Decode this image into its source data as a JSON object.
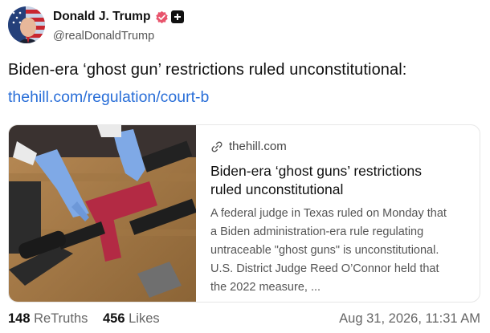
{
  "author": {
    "display_name": "Donald J. Trump",
    "handle": "@realDonaldTrump",
    "verified_color": "#e8546c",
    "avatar_icon": "flag-avatar-icon",
    "badge_icon": "plus-badge-icon"
  },
  "post": {
    "text": "Biden-era ‘ghost gun’ restrictions ruled unconstitutional:",
    "link_text": "thehill.com/regulation/court-b",
    "link_color": "#2a6fd8"
  },
  "card": {
    "domain": "thehill.com",
    "title": "Biden-era ‘ghost guns’ restrictions ruled unconstitutional",
    "description": "A federal judge in Texas ruled on Monday that a Biden administration-era rule regulating untraceable \"ghost guns\" is unconstitutional. U.S. District Judge Reed O’Connor held that the 2022 measure, ...",
    "link_icon": "link-icon",
    "image_icon": "gun-photo-image"
  },
  "stats": {
    "retruths_count": "148",
    "retruths_label": "ReTruths",
    "likes_count": "456",
    "likes_label": "Likes"
  },
  "timestamp": "Aug 31, 2026, 11:31 AM"
}
